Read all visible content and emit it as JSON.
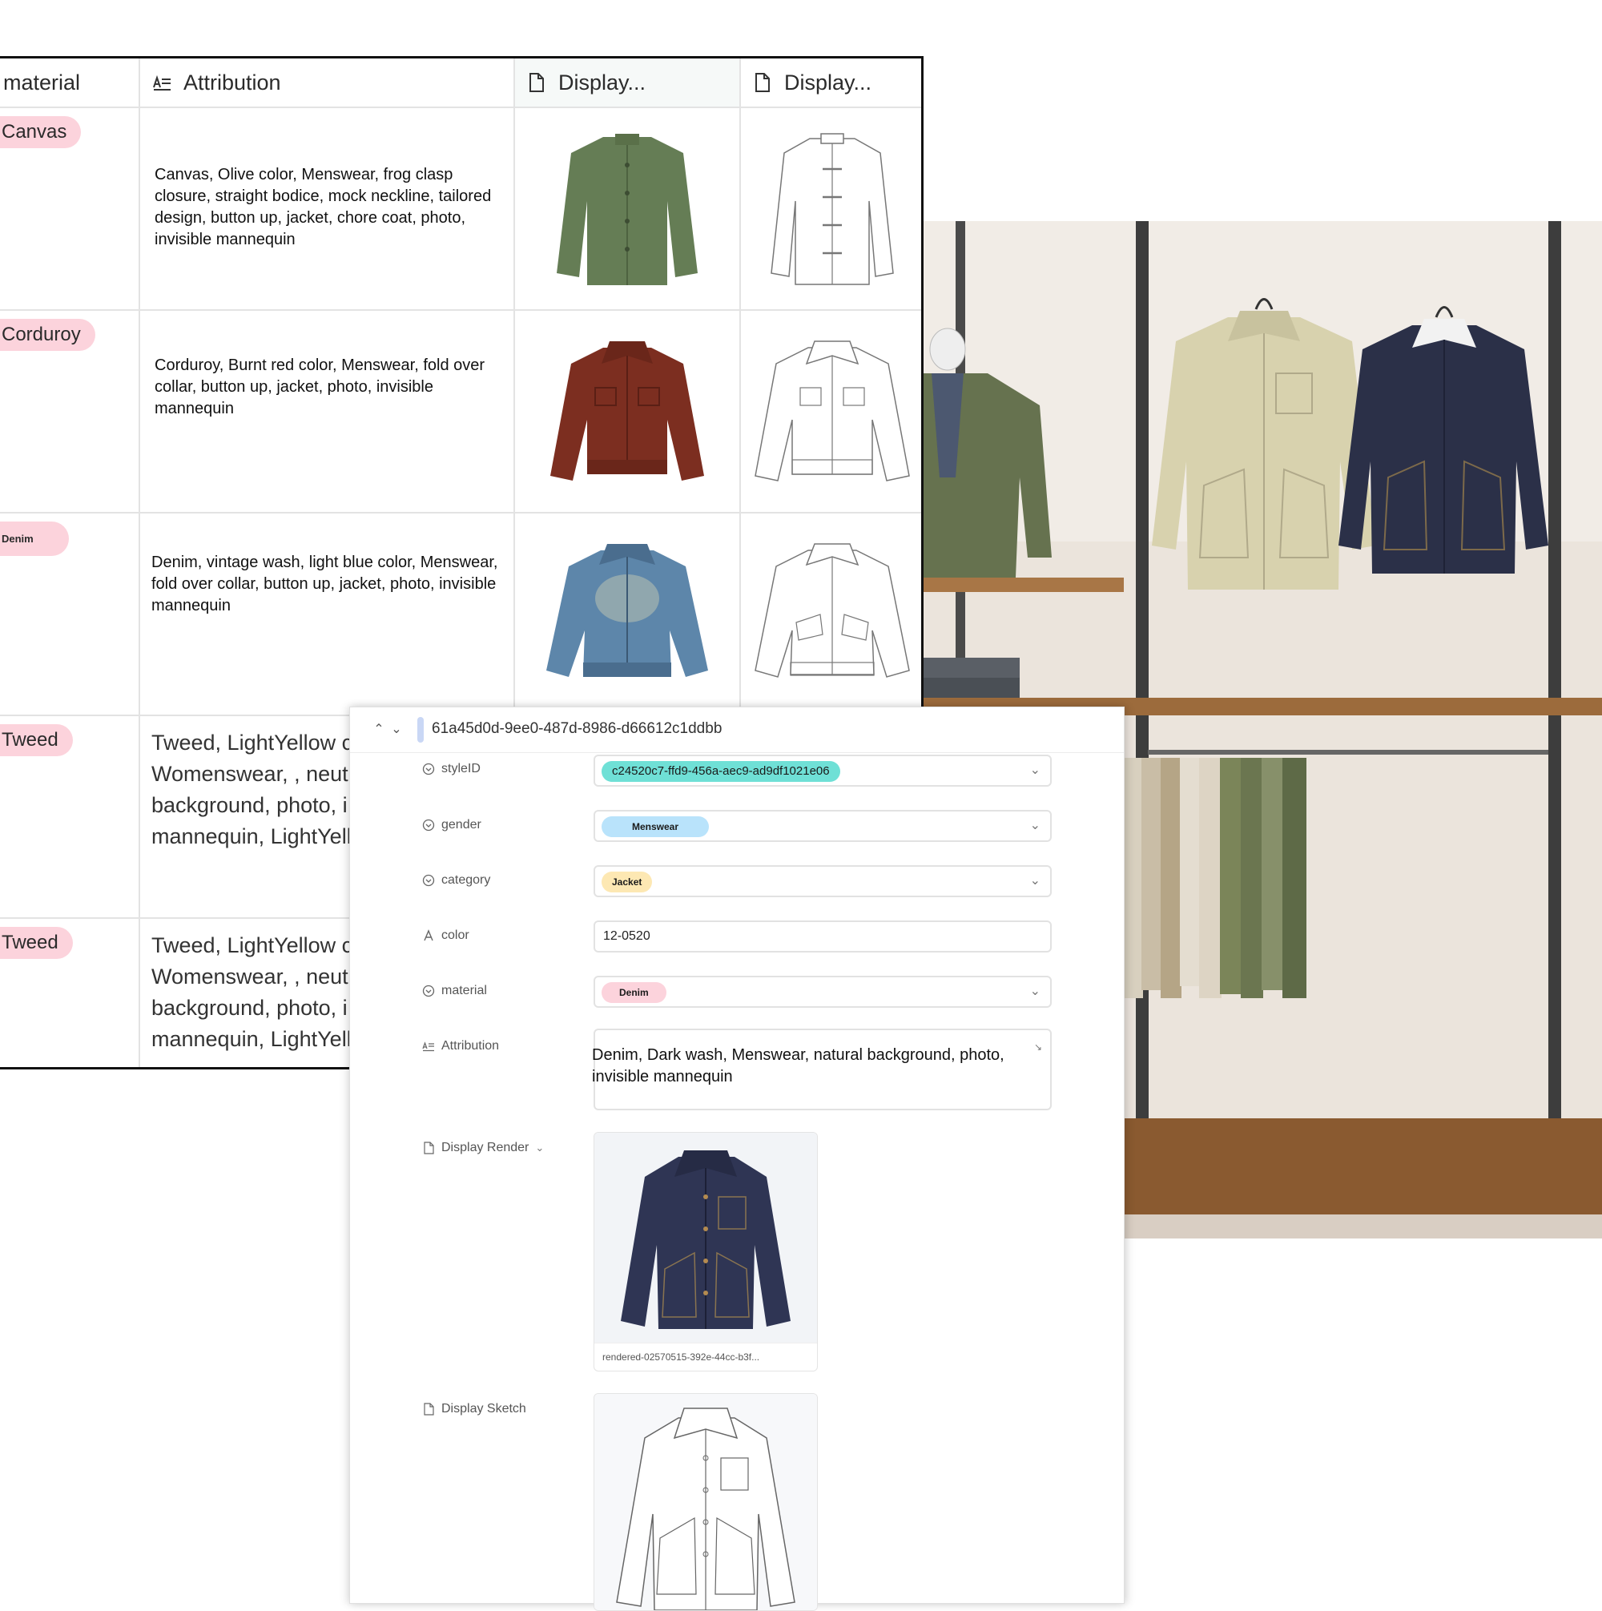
{
  "table": {
    "columns": [
      {
        "label": "material",
        "icon": "none"
      },
      {
        "label": "Attribution",
        "icon": "long-text-icon"
      },
      {
        "label": "Display...",
        "icon": "file-icon"
      },
      {
        "label": "Display...",
        "icon": "file-icon"
      }
    ],
    "rows": [
      {
        "material": "Canvas",
        "attribution": "Canvas, Olive color, Menswear, frog clasp closure, straight bodice, mock neckline, tailored design, button up, jacket, chore coat, photo, invisible mannequin"
      },
      {
        "material": "Corduroy",
        "attribution": "Corduroy, Burnt red color, Menswear, fold over collar, button up, jacket, photo, invisible mannequin"
      },
      {
        "material": "Denim",
        "attribution": "Denim, vintage wash, light blue  color, Menswear, fold over collar, button up, jacket, photo, invisible mannequin"
      },
      {
        "material": "Tweed",
        "attribution_lines": [
          "Tweed, LightYellow c",
          "Womenswear, , neutr",
          "background, photo, i",
          "mannequin, LightYell"
        ]
      },
      {
        "material": "Tweed",
        "attribution_lines": [
          "Tweed, LightYellow c",
          "Womenswear, , neutr",
          "background, photo, i",
          "mannequin, LightYell"
        ]
      }
    ]
  },
  "record": {
    "id": "61a45d0d-9ee0-487d-8986-d66612c1ddbb",
    "fields": {
      "styleID": {
        "label": "styleID",
        "value": "c24520c7-ffd9-456a-aec9-ad9df1021e06",
        "color": "#6fe0d6"
      },
      "gender": {
        "label": "gender",
        "value": "Menswear",
        "color": "#b9e3fb"
      },
      "category": {
        "label": "category",
        "value": "Jacket",
        "color": "#fde8b3"
      },
      "color": {
        "label": "color",
        "value": "12-0520"
      },
      "material": {
        "label": "material",
        "value": "Denim",
        "color": "#fcd3dc"
      },
      "attribution": {
        "label": "Attribution",
        "value": "Denim, Dark wash, Menswear, natural background, photo, invisible mannequin"
      },
      "display_render": {
        "label": "Display Render",
        "caption": "rendered-02570515-392e-44cc-b3f..."
      },
      "display_sketch": {
        "label": "Display Sketch"
      }
    }
  },
  "colors": {
    "accent_pink": "#fcd3dc",
    "border": "#e3e3e3"
  }
}
